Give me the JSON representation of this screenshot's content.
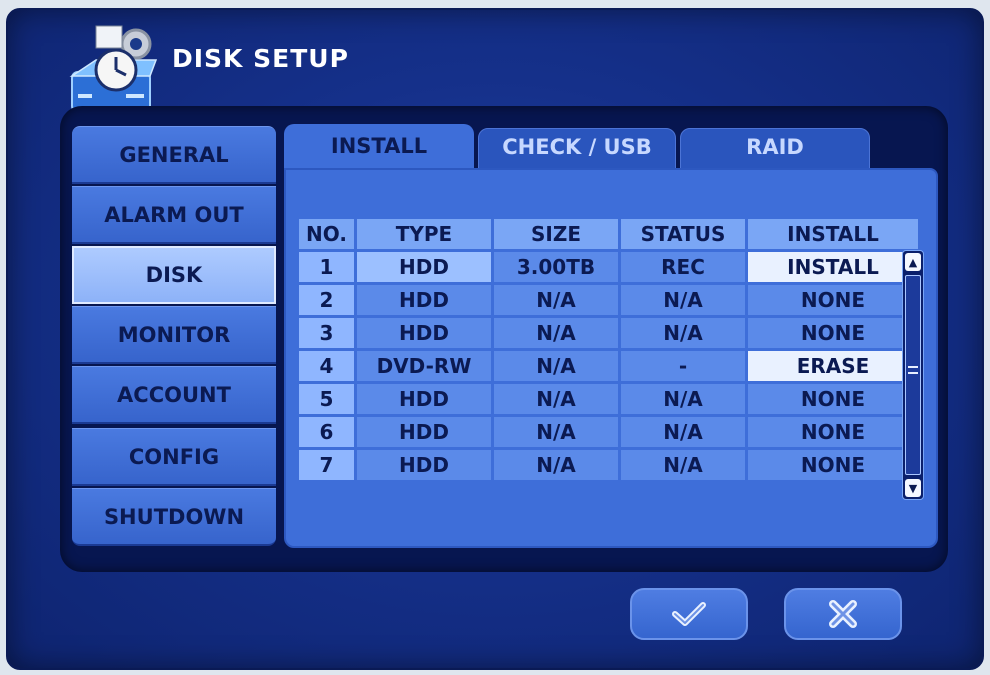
{
  "window": {
    "title": "DISK SETUP"
  },
  "sidebar": {
    "items": [
      {
        "label": "GENERAL",
        "active": false
      },
      {
        "label": "ALARM OUT",
        "active": false
      },
      {
        "label": "DISK",
        "active": true
      },
      {
        "label": "MONITOR",
        "active": false
      },
      {
        "label": "ACCOUNT",
        "active": false
      },
      {
        "label": "CONFIG",
        "active": false
      },
      {
        "label": "SHUTDOWN",
        "active": false
      }
    ]
  },
  "tabs": [
    {
      "label": "INSTALL",
      "active": true
    },
    {
      "label": "CHECK / USB",
      "active": false
    },
    {
      "label": "RAID",
      "active": false
    }
  ],
  "table": {
    "headers": [
      "NO.",
      "TYPE",
      "SIZE",
      "STATUS",
      "INSTALL"
    ],
    "rows": [
      {
        "no": "1",
        "type": "HDD",
        "size": "3.00TB",
        "status": "REC",
        "install": "INSTALL"
      },
      {
        "no": "2",
        "type": "HDD",
        "size": "N/A",
        "status": "N/A",
        "install": "NONE"
      },
      {
        "no": "3",
        "type": "HDD",
        "size": "N/A",
        "status": "N/A",
        "install": "NONE"
      },
      {
        "no": "4",
        "type": "DVD-RW",
        "size": "N/A",
        "status": "-",
        "install": "ERASE"
      },
      {
        "no": "5",
        "type": "HDD",
        "size": "N/A",
        "status": "N/A",
        "install": "NONE"
      },
      {
        "no": "6",
        "type": "HDD",
        "size": "N/A",
        "status": "N/A",
        "install": "NONE"
      },
      {
        "no": "7",
        "type": "HDD",
        "size": "N/A",
        "status": "N/A",
        "install": "NONE"
      }
    ]
  },
  "buttons": {
    "ok_icon": "checkmark-icon",
    "cancel_icon": "close-x-icon"
  },
  "colors": {
    "background": "#15308a",
    "panel": "#3e6ed9",
    "cell": "#5b8ae9",
    "header_cell": "#7aa6f5",
    "selected_cell": "#e9f1ff",
    "text": "#0b1a52"
  }
}
